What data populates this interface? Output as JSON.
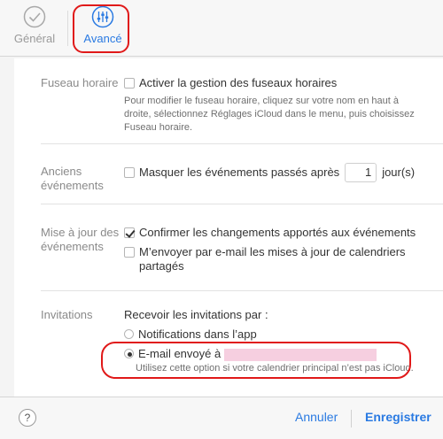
{
  "tabs": {
    "general_label": "Général",
    "advanced_label": "Avancé"
  },
  "colors": {
    "accent": "#2a7ae2",
    "highlight": "#e01919",
    "redaction": "#f6cfe0"
  },
  "sections": {
    "timezone": {
      "label": "Fuseau horaire",
      "checkbox_label": "Activer la gestion des fuseaux horaires",
      "checked": false,
      "help_lines": [
        "Pour modifier le fuseau horaire, cliquez sur votre nom en haut à",
        "droite, sélectionnez Réglages iCloud dans le menu, puis choisissez",
        "Fuseau horaire."
      ]
    },
    "old_events": {
      "label_lines": [
        "Anciens",
        "événements"
      ],
      "checkbox_label": "Masquer les événements passés après",
      "checked": false,
      "days_value": "1",
      "unit": "jour(s)"
    },
    "updates": {
      "label_lines": [
        "Mise à jour des",
        "événements"
      ],
      "option1": "Confirmer les changements apportés aux événements",
      "option1_checked": true,
      "option2_lines": [
        "M’envoyer par e-mail les mises à jour de calendriers",
        "partagés"
      ],
      "option2_checked": false
    },
    "invitations": {
      "label": "Invitations",
      "prompt": "Recevoir les invitations par :",
      "radio1": "Notifications dans l’app",
      "radio2": "E-mail envoyé à",
      "selected": "radio2",
      "help": "Utilisez cette option si votre calendrier principal n’est pas iCloud."
    }
  },
  "footer": {
    "help_label": "?",
    "cancel_label": "Annuler",
    "save_label": "Enregistrer"
  }
}
